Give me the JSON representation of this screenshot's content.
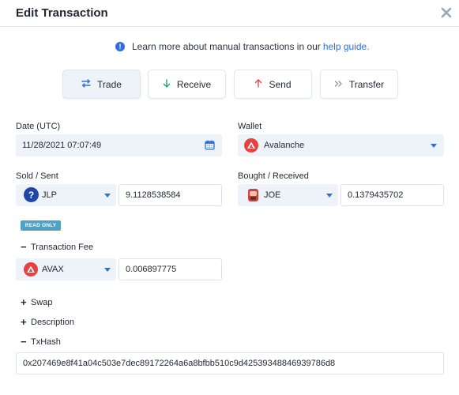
{
  "modal": {
    "title": "Edit Transaction",
    "close_icon": "close-icon"
  },
  "info": {
    "text": "Learn more about manual transactions in our",
    "link": "help guide.",
    "icon": "info-icon",
    "accent": "#2f6fde"
  },
  "tabs": [
    {
      "label": "Trade",
      "icon": "swap-arrows-icon",
      "active": true
    },
    {
      "label": "Receive",
      "icon": "arrow-down-icon",
      "active": false
    },
    {
      "label": "Send",
      "icon": "arrow-up-icon",
      "active": false
    },
    {
      "label": "Transfer",
      "icon": "double-chevron-icon",
      "active": false
    }
  ],
  "date": {
    "label": "Date (UTC)",
    "value": "11/28/2021 07:07:49",
    "icon": "calendar-icon"
  },
  "wallet": {
    "label": "Wallet",
    "value": "Avalanche",
    "icon": "avalanche-icon"
  },
  "sold": {
    "label": "Sold / Sent",
    "currency": "JLP",
    "amount": "9.1128538584",
    "icon": "question-coin-icon"
  },
  "bought": {
    "label": "Bought / Received",
    "currency": "JOE",
    "amount": "0.1379435702",
    "icon": "joe-coin-icon"
  },
  "read_only_badge": "READ ONLY",
  "fee": {
    "toggle_label": "Transaction Fee",
    "currency": "AVAX",
    "amount": "0.006897775"
  },
  "sections": {
    "swap": "Swap",
    "description": "Description",
    "txhash": "TxHash"
  },
  "txhash_value": "0x207469e8f41a04c503e7dec89172264a6a8bfbb510c9d42539348846939786d8",
  "colors": {
    "avalanche_red": "#e84142",
    "question_blue": "#1f47a8",
    "badge": "#4da3c7",
    "tab_active_bg": "#eef3fa"
  }
}
